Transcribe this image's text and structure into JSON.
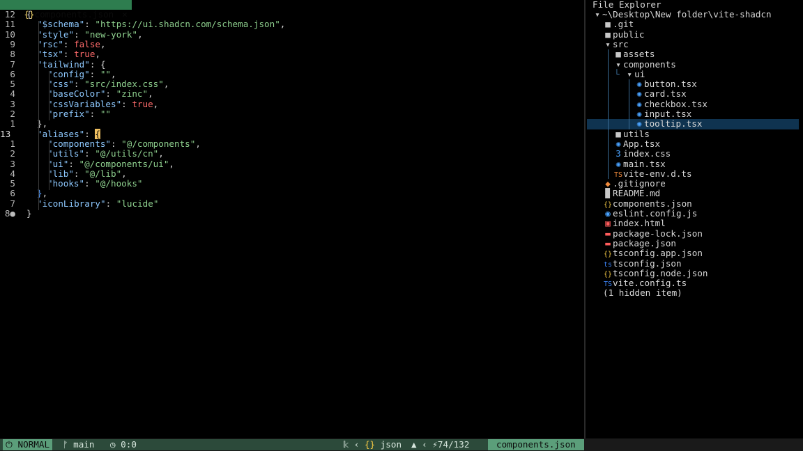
{
  "tab": {
    "icon": "{}",
    "filename": "components.json",
    "close": "×"
  },
  "editor_lines": [
    {
      "ln": "12",
      "indent": 0,
      "parts": [
        [
          "p",
          "{"
        ]
      ]
    },
    {
      "ln": "11",
      "indent": 1,
      "parts": [
        [
          "k",
          "\"$schema\""
        ],
        [
          "p",
          ": "
        ],
        [
          "s",
          "\"https://ui.shadcn.com/schema.json\""
        ],
        [
          "p",
          ","
        ]
      ]
    },
    {
      "ln": "10",
      "indent": 1,
      "parts": [
        [
          "k",
          "\"style\""
        ],
        [
          "p",
          ": "
        ],
        [
          "s",
          "\"new-york\""
        ],
        [
          "p",
          ","
        ]
      ]
    },
    {
      "ln": "9",
      "indent": 1,
      "parts": [
        [
          "k",
          "\"rsc\""
        ],
        [
          "p",
          ": "
        ],
        [
          "f",
          "false"
        ],
        [
          "p",
          ","
        ]
      ]
    },
    {
      "ln": "8",
      "indent": 1,
      "parts": [
        [
          "k",
          "\"tsx\""
        ],
        [
          "p",
          ": "
        ],
        [
          "t",
          "true"
        ],
        [
          "p",
          ","
        ]
      ]
    },
    {
      "ln": "7",
      "indent": 1,
      "parts": [
        [
          "k",
          "\"tailwind\""
        ],
        [
          "p",
          ": {"
        ]
      ]
    },
    {
      "ln": "6",
      "indent": 2,
      "parts": [
        [
          "k",
          "\"config\""
        ],
        [
          "p",
          ": "
        ],
        [
          "s",
          "\"\""
        ],
        [
          "p",
          ","
        ]
      ]
    },
    {
      "ln": "5",
      "indent": 2,
      "parts": [
        [
          "k",
          "\"css\""
        ],
        [
          "p",
          ": "
        ],
        [
          "s",
          "\"src/index.css\""
        ],
        [
          "p",
          ","
        ]
      ]
    },
    {
      "ln": "4",
      "indent": 2,
      "parts": [
        [
          "k",
          "\"baseColor\""
        ],
        [
          "p",
          ": "
        ],
        [
          "s",
          "\"zinc\""
        ],
        [
          "p",
          ","
        ]
      ]
    },
    {
      "ln": "3",
      "indent": 2,
      "parts": [
        [
          "k",
          "\"cssVariables\""
        ],
        [
          "p",
          ": "
        ],
        [
          "t",
          "true"
        ],
        [
          "p",
          ","
        ]
      ]
    },
    {
      "ln": "2",
      "indent": 2,
      "parts": [
        [
          "k",
          "\"prefix\""
        ],
        [
          "p",
          ": "
        ],
        [
          "s",
          "\"\""
        ]
      ]
    },
    {
      "ln": "1",
      "indent": 1,
      "parts": [
        [
          "p",
          "},"
        ]
      ]
    },
    {
      "ln": "13",
      "indent": 1,
      "cur": true,
      "parts": [
        [
          "k",
          "\"aliases\""
        ],
        [
          "p",
          ": "
        ],
        [
          "cursor",
          "{"
        ]
      ]
    },
    {
      "ln": "1",
      "indent": 2,
      "parts": [
        [
          "k",
          "\"components\""
        ],
        [
          "p",
          ": "
        ],
        [
          "s",
          "\"@/components\""
        ],
        [
          "p",
          ","
        ]
      ]
    },
    {
      "ln": "2",
      "indent": 2,
      "parts": [
        [
          "k",
          "\"utils\""
        ],
        [
          "p",
          ": "
        ],
        [
          "s",
          "\"@/utils/cn\""
        ],
        [
          "p",
          ","
        ]
      ]
    },
    {
      "ln": "3",
      "indent": 2,
      "parts": [
        [
          "k",
          "\"ui\""
        ],
        [
          "p",
          ": "
        ],
        [
          "s",
          "\"@/components/ui\""
        ],
        [
          "p",
          ","
        ]
      ]
    },
    {
      "ln": "4",
      "indent": 2,
      "parts": [
        [
          "k",
          "\"lib\""
        ],
        [
          "p",
          ": "
        ],
        [
          "s",
          "\"@/lib\""
        ],
        [
          "p",
          ","
        ]
      ]
    },
    {
      "ln": "5",
      "indent": 2,
      "parts": [
        [
          "k",
          "\"hooks\""
        ],
        [
          "p",
          ": "
        ],
        [
          "s",
          "\"@/hooks\""
        ]
      ]
    },
    {
      "ln": "6",
      "indent": 1,
      "parts": [
        [
          "br",
          "}"
        ],
        [
          "p",
          ","
        ]
      ]
    },
    {
      "ln": "7",
      "indent": 1,
      "parts": [
        [
          "k",
          "\"iconLibrary\""
        ],
        [
          "p",
          ": "
        ],
        [
          "s",
          "\"lucide\""
        ]
      ]
    },
    {
      "ln": "8●",
      "indent": 0,
      "parts": [
        [
          "p",
          "}"
        ]
      ]
    }
  ],
  "explorer": {
    "title": "File Explorer",
    "items": [
      {
        "depth": 0,
        "icon": "folder-open-icon",
        "glyph": "▾",
        "label": "~\\Desktop\\New folder\\vite-shadcn",
        "color": "folder"
      },
      {
        "depth": 1,
        "icon": "folder-icon",
        "glyph": "■",
        "label": ".git",
        "color": "folder"
      },
      {
        "depth": 1,
        "icon": "folder-icon",
        "glyph": "■",
        "label": "public",
        "color": "folder"
      },
      {
        "depth": 1,
        "icon": "folder-open-icon",
        "glyph": "▾",
        "label": "src",
        "color": "folder"
      },
      {
        "depth": 2,
        "icon": "folder-icon",
        "glyph": "■",
        "label": "assets",
        "color": "folder"
      },
      {
        "depth": 2,
        "icon": "folder-open-icon",
        "glyph": "▾",
        "label": "components",
        "color": "folder"
      },
      {
        "depth": 3,
        "icon": "folder-open-icon",
        "glyph": "▾",
        "label": "ui",
        "color": "folder",
        "prefix": "└ "
      },
      {
        "depth": 4,
        "icon": "react-icon",
        "glyph": "✺",
        "label": "button.tsx",
        "color": "blue"
      },
      {
        "depth": 4,
        "icon": "react-icon",
        "glyph": "✺",
        "label": "card.tsx",
        "color": "blue"
      },
      {
        "depth": 4,
        "icon": "react-icon",
        "glyph": "✺",
        "label": "checkbox.tsx",
        "color": "blue"
      },
      {
        "depth": 4,
        "icon": "react-icon",
        "glyph": "✺",
        "label": "input.tsx",
        "color": "blue"
      },
      {
        "depth": 4,
        "icon": "react-icon",
        "glyph": "✺",
        "label": "tooltip.tsx",
        "color": "blue",
        "selected": true
      },
      {
        "depth": 2,
        "icon": "folder-icon",
        "glyph": "■",
        "label": "utils",
        "color": "folder"
      },
      {
        "depth": 2,
        "icon": "react-icon",
        "glyph": "✺",
        "label": "App.tsx",
        "color": "blue"
      },
      {
        "depth": 2,
        "icon": "css-icon",
        "glyph": "3",
        "label": "index.css",
        "color": "blue"
      },
      {
        "depth": 2,
        "icon": "react-icon",
        "glyph": "✺",
        "label": "main.tsx",
        "color": "blue"
      },
      {
        "depth": 2,
        "icon": "typescript-icon",
        "glyph": "TS",
        "label": "vite-env.d.ts",
        "color": "orange"
      },
      {
        "depth": 1,
        "icon": "git-icon",
        "glyph": "◆",
        "label": ".gitignore",
        "color": "orange"
      },
      {
        "depth": 1,
        "icon": "markdown-icon",
        "glyph": "▉",
        "label": "README.md",
        "color": "folder"
      },
      {
        "depth": 1,
        "icon": "json-icon",
        "glyph": "{}",
        "label": "components.json",
        "color": "yellow"
      },
      {
        "depth": 1,
        "icon": "eslint-icon",
        "glyph": "◉",
        "label": "eslint.config.js",
        "color": "blue"
      },
      {
        "depth": 1,
        "icon": "html-icon",
        "glyph": "▣",
        "label": "index.html",
        "color": "red"
      },
      {
        "depth": 1,
        "icon": "npm-icon",
        "glyph": "▬",
        "label": "package-lock.json",
        "color": "red"
      },
      {
        "depth": 1,
        "icon": "npm-icon",
        "glyph": "▬",
        "label": "package.json",
        "color": "red"
      },
      {
        "depth": 1,
        "icon": "json-icon",
        "glyph": "{}",
        "label": "tsconfig.app.json",
        "color": "yellow"
      },
      {
        "depth": 1,
        "icon": "typescript-config-icon",
        "glyph": "ts",
        "label": "tsconfig.json",
        "color": "tsblue"
      },
      {
        "depth": 1,
        "icon": "json-icon",
        "glyph": "{}",
        "label": "tsconfig.node.json",
        "color": "yellow"
      },
      {
        "depth": 1,
        "icon": "typescript-icon",
        "glyph": "TS",
        "label": "vite.config.ts",
        "color": "tsblue"
      },
      {
        "depth": 1,
        "icon": "",
        "glyph": "",
        "label": "(1 hidden item)",
        "color": "folder"
      }
    ]
  },
  "status": {
    "mode": "NORMAL",
    "branch": "main",
    "diagnostics": "0:0",
    "filetype": "json",
    "position": "74/132",
    "filename": "components.json",
    "colors": {
      "accent": "#5b9e7a",
      "bar": "#2c4a3a"
    }
  }
}
